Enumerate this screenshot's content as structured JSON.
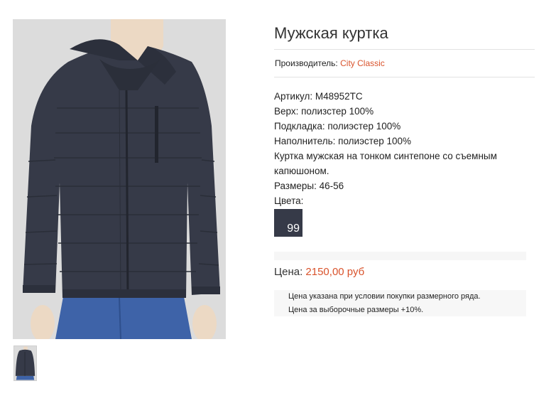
{
  "product": {
    "title": "Мужская куртка",
    "manufacturer_label": "Производитель:",
    "manufacturer": "City Classic",
    "specs": {
      "article": "Артикул: M48952TC",
      "outer": "Верх: полизстер 100%",
      "lining": "Подкладка: полиэстер 100%",
      "filling": "Наполнитель: полиэстер 100%",
      "description": "Куртка мужская на тонком синтепоне со съемным капюшоном.",
      "sizes": "Размеры: 46-56",
      "colors_label": "Цвета:"
    },
    "colors": [
      {
        "code": "99",
        "hex": "#363a48"
      }
    ],
    "price_label": "Цена:",
    "price": "2150,00 руб",
    "note_line1": "Цена указана при условии покупки размерного ряда.",
    "note_line2": "Цена за выборочные размеры +10%."
  },
  "theme": {
    "accent": "#d9532c",
    "jacket": "#363a48",
    "background": "#dcdcdc"
  }
}
